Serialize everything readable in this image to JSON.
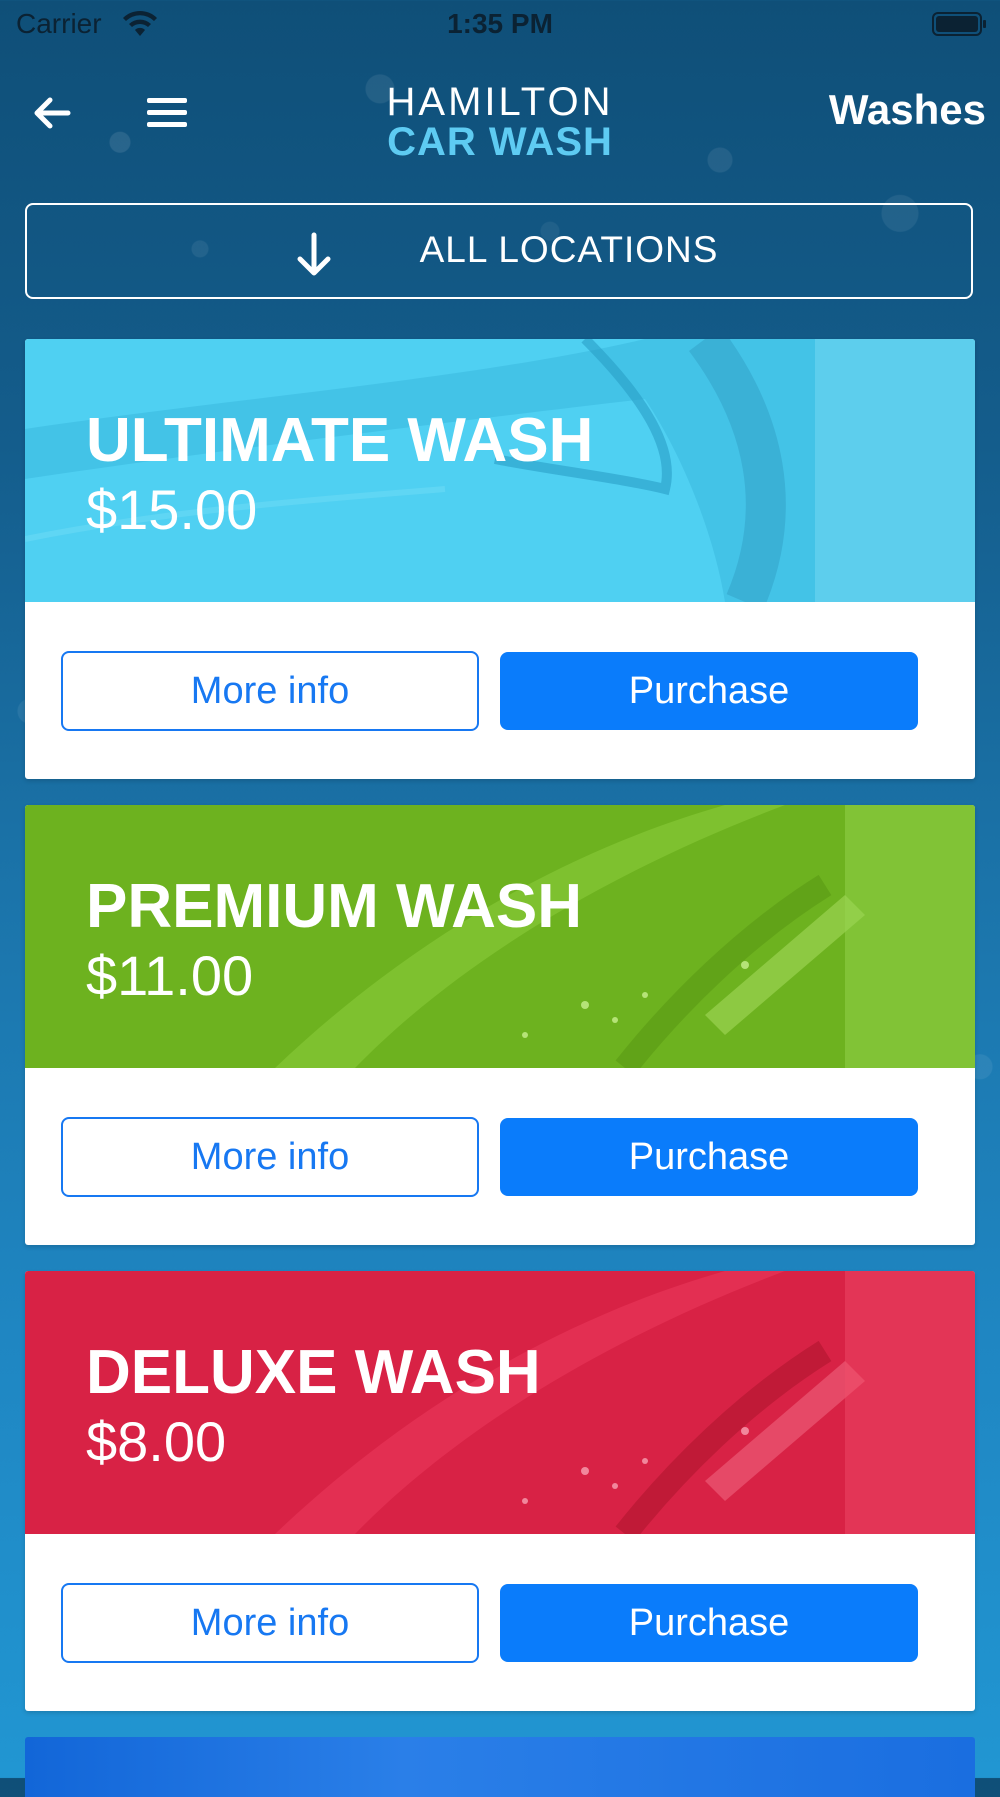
{
  "status_bar": {
    "carrier": "Carrier",
    "time": "1:35 PM"
  },
  "nav": {
    "logo_top": "HAMILTON",
    "logo_bottom": "CAR WASH",
    "title": "Washes"
  },
  "location": {
    "label": "ALL LOCATIONS"
  },
  "colors": {
    "ultimate": "#4fd0f2",
    "premium": "#6db21f",
    "deluxe": "#d82245",
    "purchase_button": "#0a7cfb",
    "more_info_border": "#1778f2"
  },
  "washes": [
    {
      "name": "ULTIMATE WASH",
      "price": "$15.00",
      "more_label": "More info",
      "buy_label": "Purchase"
    },
    {
      "name": "PREMIUM WASH",
      "price": "$11.00",
      "more_label": "More info",
      "buy_label": "Purchase"
    },
    {
      "name": "DELUXE WASH",
      "price": "$8.00",
      "more_label": "More info",
      "buy_label": "Purchase"
    }
  ]
}
